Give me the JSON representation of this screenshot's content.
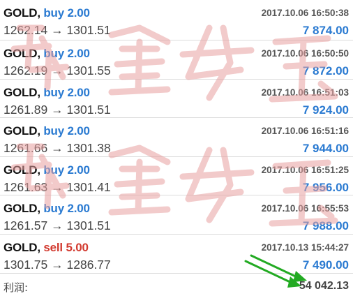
{
  "trades": [
    {
      "symbol": "GOLD",
      "direction": "buy",
      "volume": "buy 2.00",
      "open_price": "1262.14",
      "close_price": "1301.51",
      "time": "2017.10.06 16:50:38",
      "profit": "7 874.00"
    },
    {
      "symbol": "GOLD",
      "direction": "buy",
      "volume": "buy 2.00",
      "open_price": "1262.19",
      "close_price": "1301.55",
      "time": "2017.10.06 16:50:50",
      "profit": "7 872.00"
    },
    {
      "symbol": "GOLD",
      "direction": "buy",
      "volume": "buy 2.00",
      "open_price": "1261.89",
      "close_price": "1301.51",
      "time": "2017.10.06 16:51:03",
      "profit": "7 924.00"
    },
    {
      "symbol": "GOLD",
      "direction": "buy",
      "volume": "buy 2.00",
      "open_price": "1261.66",
      "close_price": "1301.38",
      "time": "2017.10.06 16:51:16",
      "profit": "7 944.00"
    },
    {
      "symbol": "GOLD",
      "direction": "buy",
      "volume": "buy 2.00",
      "open_price": "1261.63",
      "close_price": "1301.41",
      "time": "2017.10.06 16:51:25",
      "profit": "7 956.00"
    },
    {
      "symbol": "GOLD",
      "direction": "buy",
      "volume": "buy 2.00",
      "open_price": "1261.57",
      "close_price": "1301.51",
      "time": "2017.10.06 16:55:53",
      "profit": "7 988.00"
    },
    {
      "symbol": "GOLD",
      "direction": "sell",
      "volume": "sell 5.00",
      "open_price": "1301.75",
      "close_price": "1286.77",
      "time": "2017.10.13 15:44:27",
      "profit": "7 490.00"
    }
  ],
  "arrow_glyph": "→",
  "comma": ",",
  "summary": {
    "label": "利润:",
    "value": "54 042.13"
  },
  "watermark": {
    "text": "踏金女王",
    "color": "#e8a0a0"
  },
  "colors": {
    "buy": "#2a7ad1",
    "sell": "#d23a2f",
    "profit": "#2a7ad1",
    "arrow": "#22aa22"
  }
}
